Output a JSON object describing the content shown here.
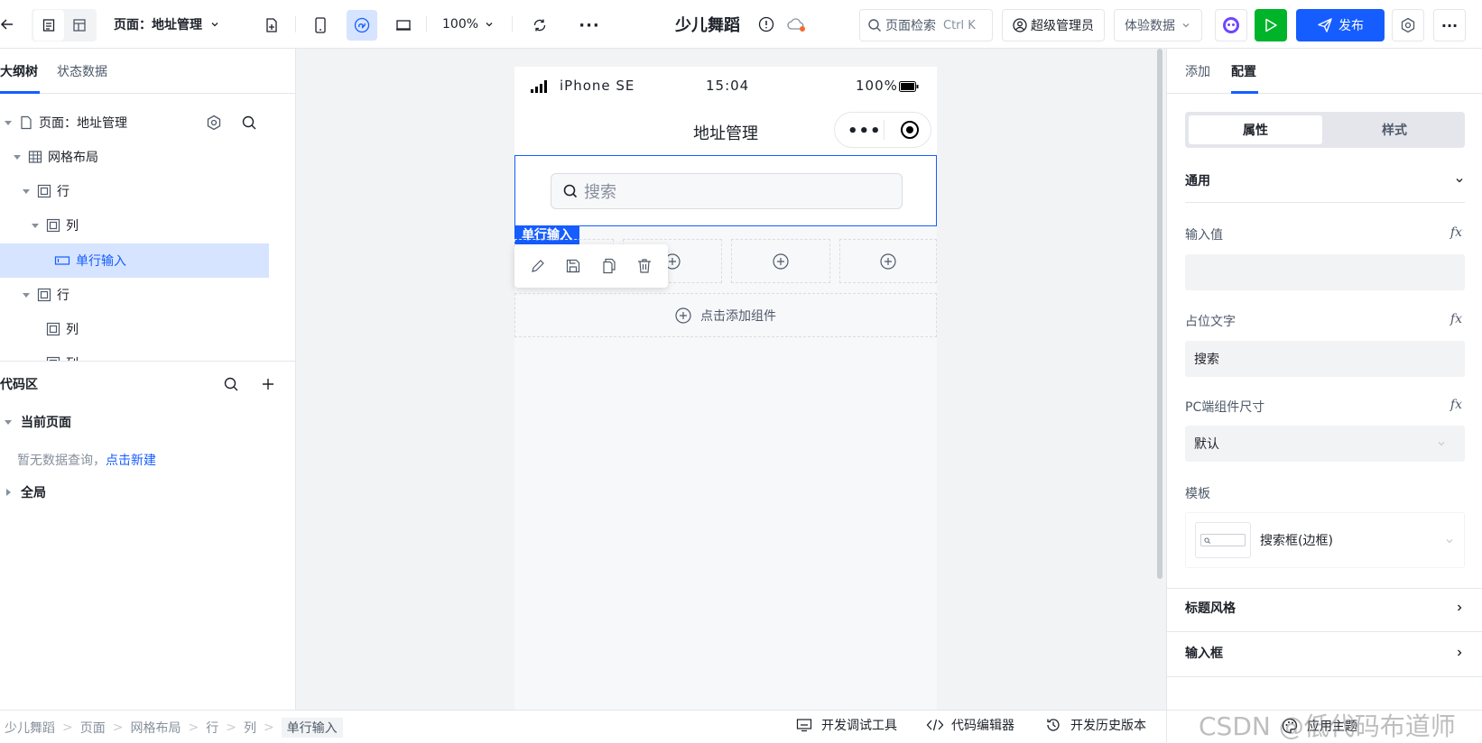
{
  "topbar": {
    "page_select": "页面：地址管理",
    "zoom": "100%",
    "app_name": "少儿舞蹈",
    "search_label": "页面检索",
    "search_shortcut": "Ctrl K",
    "admin_label": "超级管理员",
    "data_select": "体验数据",
    "publish_label": "发布"
  },
  "left": {
    "tabs": [
      "大纲树",
      "状态数据"
    ],
    "tree": [
      {
        "label": "页面：地址管理",
        "icon": "page-icon"
      },
      {
        "label": "网格布局",
        "icon": "grid-icon"
      },
      {
        "label": "行",
        "icon": "row-icon"
      },
      {
        "label": "列",
        "icon": "col-icon"
      },
      {
        "label": "单行输入",
        "icon": "input-icon"
      },
      {
        "label": "行",
        "icon": "row-icon"
      },
      {
        "label": "列",
        "icon": "col-icon"
      },
      {
        "label": "列",
        "icon": "col-icon"
      }
    ],
    "code_title": "代码区",
    "current_page": "当前页面",
    "empty_text": "暂无数据查询，",
    "create_link": "点击新建",
    "global_label": "全局"
  },
  "phone": {
    "carrier": "iPhone SE",
    "time": "15:04",
    "battery": "100%",
    "title": "地址管理",
    "search_placeholder": "搜索",
    "selected_tag": "单行输入",
    "add_component": "点击添加组件"
  },
  "right": {
    "tabs": [
      "添加",
      "配置"
    ],
    "seg": [
      "属性",
      "样式"
    ],
    "general": "通用",
    "input_value_label": "输入值",
    "placeholder_label": "占位文字",
    "placeholder_value": "搜索",
    "size_label": "PC端组件尺寸",
    "size_value": "默认",
    "template_label": "模板",
    "template_value": "搜索框(边框)",
    "title_style": "标题风格",
    "input_box": "输入框"
  },
  "bottom": {
    "breadcrumb": [
      "少儿舞蹈",
      "页面",
      "网格布局",
      "行",
      "列",
      "单行输入"
    ],
    "devtools": "开发调试工具",
    "code_editor": "代码编辑器",
    "history": "开发历史版本",
    "theme": "应用主题",
    "watermark": "CSDN @低代码布道师"
  },
  "colors": {
    "accent": "#165dff",
    "run": "#00b42a",
    "selected_bg": "#d6e4ff"
  }
}
